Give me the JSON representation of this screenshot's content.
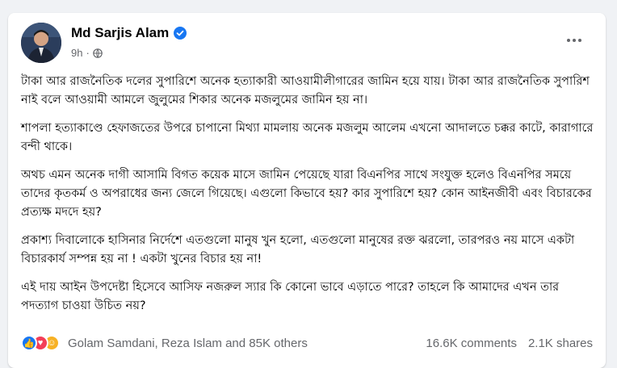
{
  "post": {
    "author": "Md Sarjis Alam",
    "time": "9h",
    "paragraphs": [
      "টাকা আর রাজনৈতিক দলের সুপারিশে অনেক হত্যাকারী আওয়ামীলীগারের জামিন হয়ে যায়। টাকা আর রাজনৈতিক সুপারিশ নাই বলে আওয়ামী আমলে জুলুমের শিকার অনেক মজলুমের জামিন হয় না।",
      "শাপলা হত্যাকাণ্ডে হেফাজতের উপরে চাপানো মিথ্যা মামলায় অনেক মজলুম আলেম এখনো আদালতে চক্কর কাটে, কারাগারে বন্দী থাকে।",
      "অথচ এমন অনেক দাগী আসামি বিগত কয়েক মাসে জামিন পেয়েছে যারা বিএনপির সাথে সংযুক্ত হলেও বিএনপির সময়ে তাদের কৃতকর্ম ও অপরাধের জন্য জেলে গিয়েছে। এগুলো কিভাবে হয়? কার সুপারিশে হয়? কোন আইনজীবী এবং বিচারকের প্রত্যক্ষ মদদে হয়?",
      "প্রকাশ্য দিবালোকে হাসিনার নির্দেশে এতগুলো মানুষ খুন হলো, এতগুলো মানুষের রক্ত ঝরলো, তারপরও নয় মাসে একটা বিচারকার্য সম্পন্ন হয় না ! একটা খুনের বিচার হয় না!",
      "এই দায় আইন উপদেষ্টা হিসেবে আসিফ নজরুল স্যার কি কোনো ভাবে এড়াতে পারে? তাহলে কি আমাদের এখন তার পদত্যাগ চাওয়া উচিত নয়?"
    ]
  },
  "footer": {
    "reactions": [
      "like-icon",
      "love-icon",
      "haha-icon"
    ],
    "reaction_names": "Golam Samdani, Reza Islam and 85K others",
    "comments": "16.6K comments",
    "shares": "2.1K shares"
  },
  "colors": {
    "background": "#f0f2f5",
    "card": "#ffffff",
    "verified": "#1877f2",
    "secondary_text": "#65676b"
  }
}
